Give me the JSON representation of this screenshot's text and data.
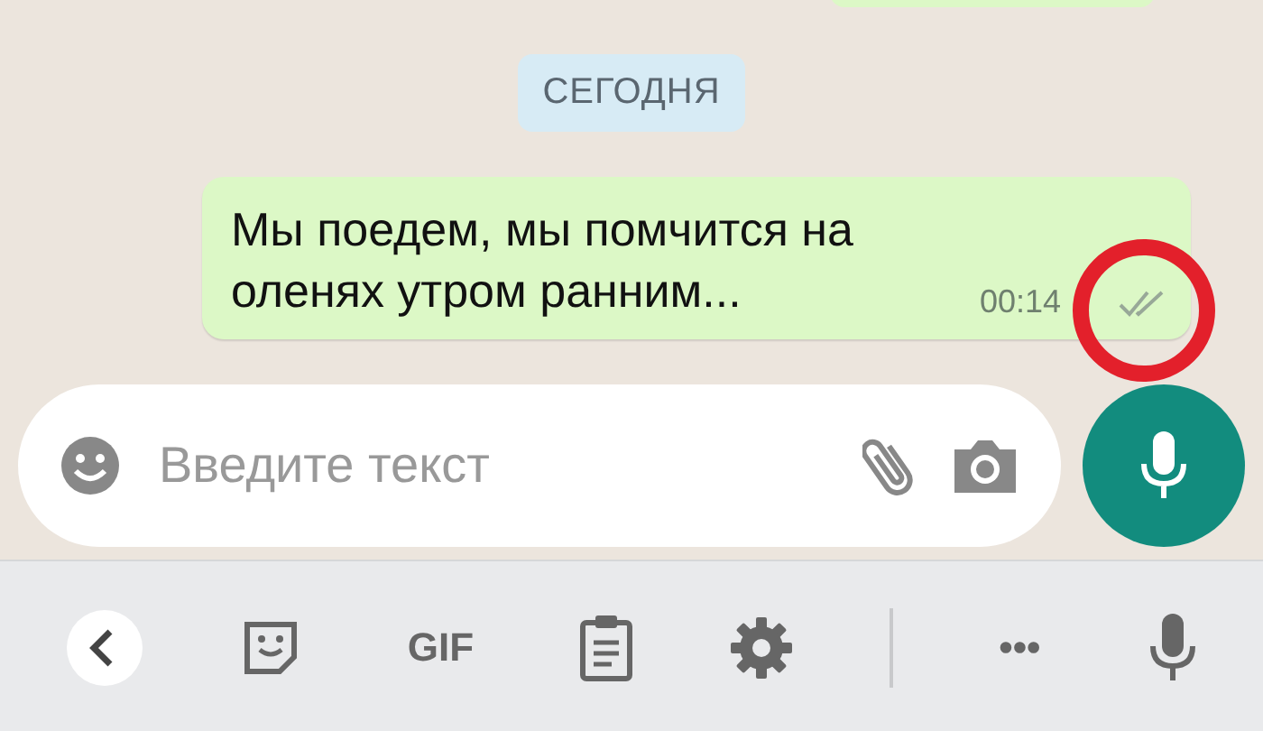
{
  "chat": {
    "date_chip": "СЕГОДНЯ",
    "message": {
      "lines": [
        "Мы поедем, мы помчится на",
        "оленях утром ранним..."
      ],
      "time": "00:14",
      "delivered": true
    }
  },
  "annotation": {
    "kind": "ring"
  },
  "composer": {
    "placeholder": "Введите текст"
  },
  "keyboard_toolbar": {
    "items": [
      {
        "kind": "back"
      },
      {
        "kind": "sticker"
      },
      {
        "kind": "text",
        "label": "GIF"
      },
      {
        "kind": "clipboard"
      },
      {
        "kind": "settings"
      },
      {
        "kind": "divider"
      },
      {
        "kind": "text",
        "label": "•••"
      },
      {
        "kind": "mic"
      }
    ]
  }
}
